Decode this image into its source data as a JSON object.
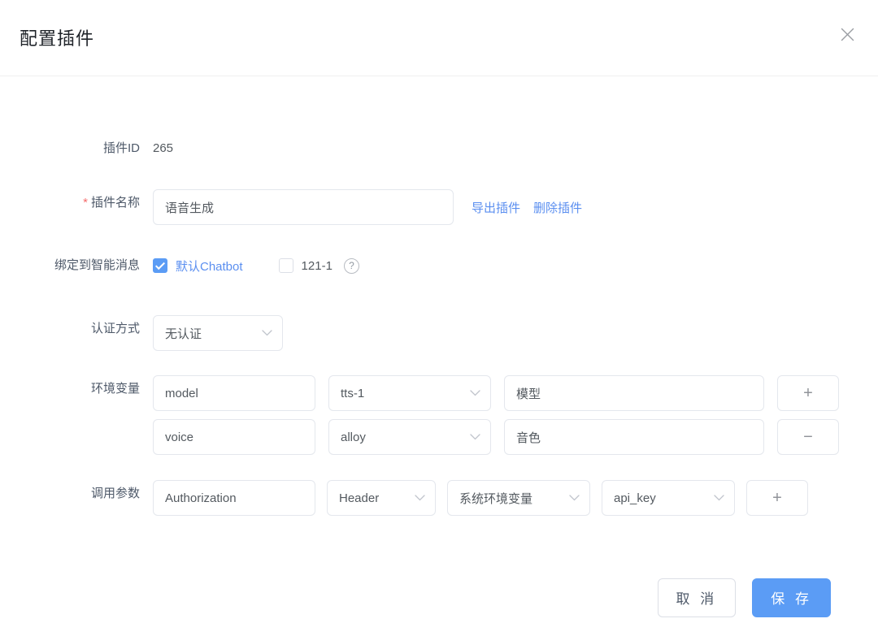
{
  "dialog": {
    "title": "配置插件",
    "close_icon": "close-icon"
  },
  "form": {
    "plugin_id": {
      "label": "插件ID",
      "value": "265"
    },
    "plugin_name": {
      "label": "插件名称",
      "required_mark": "*",
      "value": "语音生成",
      "placeholder": "",
      "actions": [
        {
          "label": "导出插件",
          "name": "export-plugin-link"
        },
        {
          "label": "删除插件",
          "name": "delete-plugin-link"
        }
      ]
    },
    "bind_message": {
      "label": "绑定到智能消息",
      "options": [
        {
          "label": "默认Chatbot",
          "checked": true
        },
        {
          "label": "121-1",
          "checked": false
        }
      ],
      "help_icon": "question-mark-icon"
    },
    "auth_method": {
      "label": "认证方式",
      "value": "无认证"
    },
    "env_vars": {
      "label": "环境变量",
      "rows": [
        {
          "key": "model",
          "select": "tts-1",
          "desc": "模型",
          "action": "+",
          "action_name": "add-env-var-button"
        },
        {
          "key": "voice",
          "select": "alloy",
          "desc": "音色",
          "action": "−",
          "action_name": "remove-env-var-button"
        }
      ]
    },
    "call_params": {
      "label": "调用参数",
      "rows": [
        {
          "name": "Authorization",
          "location": "Header",
          "source": "系统环境变量",
          "value": "api_key",
          "action": "+",
          "action_name": "add-call-param-button"
        }
      ]
    }
  },
  "footer": {
    "cancel_label": "取 消",
    "save_label": "保 存"
  },
  "colors": {
    "primary": "#5b9cf5",
    "link": "#5b8ff0",
    "required": "#f56c6c",
    "border": "#e4e7ed"
  }
}
